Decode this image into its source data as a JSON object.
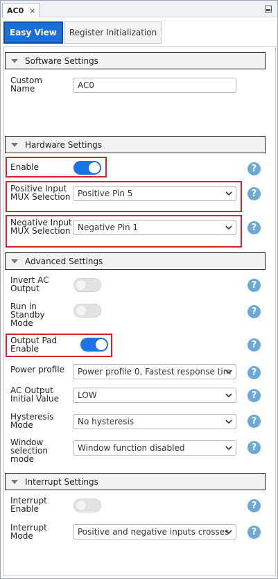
{
  "window": {
    "tab_title": "AC0",
    "close_glyph": "×"
  },
  "view_tabs": [
    {
      "label": "Easy View"
    },
    {
      "label": "Register Initialization"
    }
  ],
  "sections": {
    "software": "Software Settings",
    "hardware": "Hardware Settings",
    "advanced": "Advanced Settings",
    "interrupt": "Interrupt Settings"
  },
  "software": {
    "custom_name_label": "Custom Name",
    "custom_name_value": "AC0"
  },
  "hardware": {
    "enable_label": "Enable",
    "enable_on": true,
    "pos_mux_label": "Positive Input MUX Selection",
    "pos_mux_value": "Positive Pin 5",
    "neg_mux_label": "Negative Input MUX Selection",
    "neg_mux_value": "Negative Pin 1"
  },
  "advanced": {
    "invert_label": "Invert AC Output",
    "invert_on": false,
    "standby_label": "Run in Standby Mode",
    "standby_on": false,
    "output_pad_label": "Output Pad Enable",
    "output_pad_on": true,
    "power_label": "Power profile",
    "power_value": "Power profile 0, Fastest response tim",
    "initial_label": "AC Output Initial Value",
    "initial_value": "LOW",
    "hysteresis_label": "Hysteresis Mode",
    "hysteresis_value": "No hysteresis",
    "window_label": "Window selection mode",
    "window_value": "Window function disabled"
  },
  "interrupt": {
    "int_enable_label": "Interrupt Enable",
    "int_enable_on": false,
    "int_mode_label": "Interrupt Mode",
    "int_mode_value": "Positive and negative inputs crosses"
  },
  "help_glyph": "?",
  "colors": {
    "accent": "#1a73e8",
    "highlight": "#d6222e",
    "help": "#6aa9d8"
  }
}
